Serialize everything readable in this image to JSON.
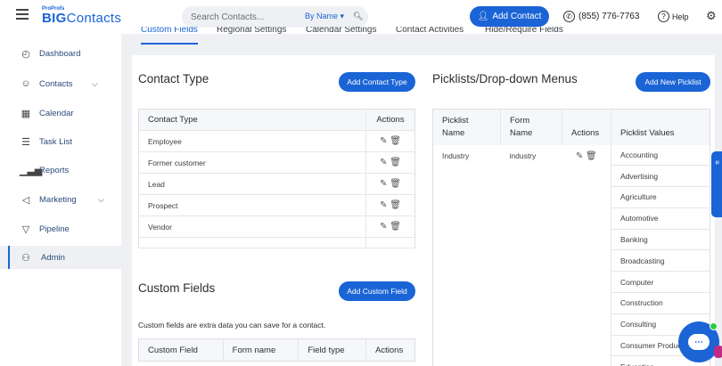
{
  "header": {
    "logo_small": "ProProfs",
    "logo_big_bold": "BIG",
    "logo_big_rest": "Contacts",
    "search_placeholder": "Search Contacts...",
    "search_by": "By Name ▾",
    "add_contact_label": "Add Contact",
    "phone": "(855) 776-7763",
    "help_label": "Help"
  },
  "sidebar": {
    "items": [
      {
        "label": "Dashboard",
        "icon": "dashboard-icon"
      },
      {
        "label": "Contacts",
        "icon": "contacts-icon"
      },
      {
        "label": "Calendar",
        "icon": "calendar-icon"
      },
      {
        "label": "Task List",
        "icon": "task-list-icon"
      },
      {
        "label": "Reports",
        "icon": "reports-icon"
      },
      {
        "label": "Marketing",
        "icon": "marketing-icon"
      },
      {
        "label": "Pipeline",
        "icon": "pipeline-icon"
      },
      {
        "label": "Admin",
        "icon": "admin-icon"
      }
    ]
  },
  "tabs": [
    "Custom Fields",
    "Regional Settings",
    "Calendar Settings",
    "Contact Activities",
    "Hide/Require Fields"
  ],
  "contact_type": {
    "title": "Contact Type",
    "add_button": "Add Contact Type",
    "col_type": "Contact Type",
    "col_actions": "Actions",
    "rows": [
      "Employee",
      "Former customer",
      "Lead",
      "Prospect",
      "Vendor"
    ]
  },
  "custom_fields": {
    "title": "Custom Fields",
    "add_button": "Add Custom Field",
    "description": "Custom fields are extra data you can save for a contact.",
    "columns": [
      "Custom Field",
      "Form name",
      "Field type",
      "Actions"
    ]
  },
  "picklists": {
    "title": "Picklists/Drop-down Menus",
    "add_button": "Add New Picklist",
    "col_picklist_name": "Picklist Name",
    "col_form_name": "Form Name",
    "col_actions": "Actions",
    "col_values": "Picklist Values",
    "row": {
      "picklist_name": "Industry",
      "form_name": "industry"
    },
    "values": [
      "Accounting",
      "Advertising",
      "Agriculture",
      "Automotive",
      "Banking",
      "Broadcasting",
      "Computer",
      "Construction",
      "Consulting",
      "Consumer Products",
      "Education"
    ]
  },
  "colors": {
    "accent": "#1a64d6",
    "background": "#eef0f3"
  }
}
